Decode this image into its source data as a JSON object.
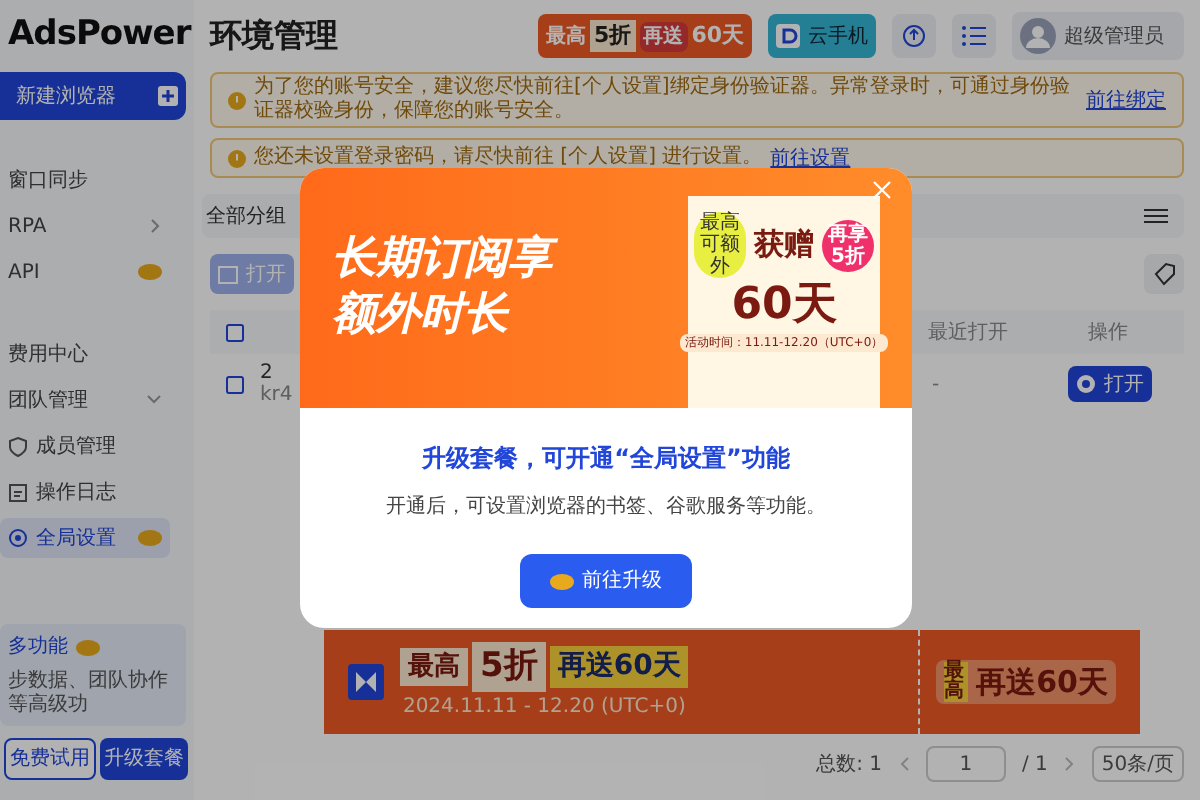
{
  "logo": "AdsPower",
  "new_browser": "新建浏览器",
  "sidebar": {
    "items": [
      {
        "label": "窗口同步",
        "kind": "plain",
        "selected": false
      },
      {
        "label": "RPA",
        "kind": "arrow",
        "selected": false
      },
      {
        "label": "API",
        "kind": "premium",
        "selected": false
      },
      {
        "label": "费用中心",
        "kind": "plain",
        "selected": false
      },
      {
        "label": "团队管理",
        "kind": "chevron",
        "selected": false
      },
      {
        "label": "成员管理",
        "kind": "shield",
        "selected": false
      },
      {
        "label": "操作日志",
        "kind": "log",
        "selected": false
      },
      {
        "label": "全局设置",
        "kind": "gear",
        "selected": true
      }
    ],
    "upsell": {
      "title": "多功能",
      "text": "步数据、团队协作等高级功",
      "buttons": [
        "免费试用",
        "升级套餐"
      ]
    }
  },
  "header": {
    "title": "环境管理",
    "promo": {
      "label": "最高",
      "discount": "5折",
      "gift": "再送",
      "days": "60天"
    },
    "cloud_phone": "云手机",
    "user_role": "超级管理员"
  },
  "notices": [
    {
      "text": "为了您的账号安全，建议您尽快前往[个人设置]绑定身份验证器。异常登录时，可通过身份验证器校验身份，保障您的账号安全。",
      "link": "前往绑定"
    },
    {
      "text": "您还未设置登录密码，请尽快前往 [个人设置] 进行设置。",
      "link": "前往设置"
    }
  ],
  "toolbar": {
    "group": "全部分组",
    "open": "打开"
  },
  "table": {
    "columns": [
      "最近打开",
      "操作"
    ],
    "rows": [
      {
        "number": "2",
        "name": "kr4",
        "last_opened": "-",
        "action": "打开",
        "checked": false
      }
    ]
  },
  "pagination": {
    "total": "总数: 1",
    "page": "1",
    "pages": "/ 1",
    "per_page": "50条/页"
  },
  "modal": {
    "banner": {
      "lines": [
        "长期订阅享",
        "额外时长"
      ],
      "gift": "获赠",
      "days": "60天",
      "extra": "再享5折",
      "max": "最高可额外",
      "period": "活动时间：11.11-12.20（UTC+0）"
    },
    "heading": "升级套餐，可开通“全局设置”功能",
    "description": "开通后，可设置浏览器的书签、谷歌服务等功能。",
    "button": "前往升级"
  },
  "bottom_banner": {
    "label": "最高",
    "discount": "5折",
    "gift": "再送60天",
    "period": "2024.11.11 - 12.20 (UTC+0)",
    "label_2": "最高",
    "gift_2": "再送60天"
  }
}
